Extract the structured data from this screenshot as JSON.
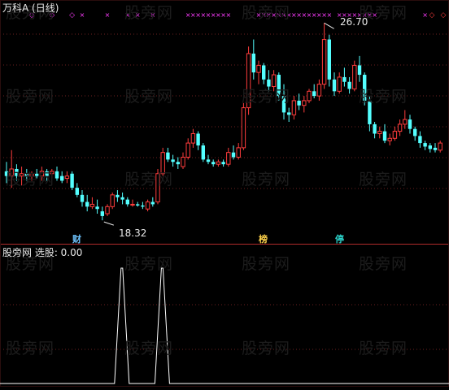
{
  "header": {
    "title": "万科A (日线)"
  },
  "price_panel": {
    "high_label": "26.70",
    "low_label": "18.32",
    "tags": [
      {
        "text": "财",
        "color": "#6fc5ff"
      },
      {
        "text": "榜",
        "color": "#ffd24a"
      },
      {
        "text": "停",
        "color": "#2bd1c9"
      }
    ],
    "colors": {
      "up": "#ff3c3c",
      "down": "#54ffff",
      "marker": "#ff3cff",
      "grid": "#6b1f1f",
      "divider": "#b02b2b"
    },
    "price_range": [
      17.6,
      27.4
    ],
    "candles": [
      [
        20.4,
        20.8,
        19.9,
        20.2
      ],
      [
        20.2,
        21.3,
        19.7,
        20.5
      ],
      [
        20.5,
        20.7,
        20.0,
        20.2
      ],
      [
        20.2,
        20.6,
        19.8,
        20.3
      ],
      [
        20.3,
        20.5,
        20.0,
        20.2
      ],
      [
        20.2,
        20.4,
        20.0,
        20.3
      ],
      [
        20.3,
        20.5,
        20.1,
        20.2
      ],
      [
        20.2,
        20.6,
        20.0,
        20.4
      ],
      [
        20.4,
        20.5,
        20.0,
        20.2
      ],
      [
        20.3,
        20.5,
        20.1,
        20.4
      ],
      [
        20.4,
        20.6,
        20.0,
        20.1
      ],
      [
        20.2,
        20.4,
        19.9,
        20.0
      ],
      [
        20.1,
        20.4,
        19.9,
        20.2
      ],
      [
        20.3,
        20.4,
        19.6,
        19.7
      ],
      [
        19.7,
        19.9,
        19.3,
        19.4
      ],
      [
        19.4,
        19.6,
        18.9,
        19.1
      ],
      [
        19.1,
        19.4,
        18.7,
        18.9
      ],
      [
        18.9,
        19.3,
        18.8,
        19.0
      ],
      [
        18.9,
        19.2,
        18.6,
        18.8
      ],
      [
        18.7,
        18.9,
        18.32,
        18.5
      ],
      [
        18.6,
        19.0,
        18.5,
        18.9
      ],
      [
        18.9,
        19.5,
        18.8,
        19.4
      ],
      [
        19.4,
        19.6,
        19.1,
        19.3
      ],
      [
        19.3,
        19.5,
        19.0,
        19.2
      ],
      [
        19.2,
        19.3,
        18.9,
        19.0
      ],
      [
        19.0,
        19.2,
        18.9,
        19.0
      ],
      [
        19.0,
        19.1,
        18.9,
        18.95
      ],
      [
        18.95,
        19.1,
        18.8,
        18.9
      ],
      [
        18.8,
        19.2,
        18.7,
        19.1
      ],
      [
        19.1,
        19.3,
        18.9,
        19.0
      ],
      [
        19.1,
        20.5,
        19.0,
        20.3
      ],
      [
        20.3,
        21.4,
        20.2,
        21.2
      ],
      [
        21.2,
        21.4,
        20.8,
        20.9
      ],
      [
        20.9,
        21.1,
        20.6,
        20.8
      ],
      [
        20.8,
        21.0,
        20.5,
        20.7
      ],
      [
        20.6,
        21.2,
        20.5,
        21.0
      ],
      [
        21.0,
        21.8,
        20.9,
        21.6
      ],
      [
        21.6,
        22.2,
        21.4,
        22.0
      ],
      [
        22.0,
        22.1,
        21.3,
        21.5
      ],
      [
        21.5,
        21.6,
        20.8,
        20.9
      ],
      [
        20.9,
        21.1,
        20.7,
        20.8
      ],
      [
        20.8,
        20.9,
        20.6,
        20.7
      ],
      [
        20.7,
        20.9,
        20.6,
        20.8
      ],
      [
        20.8,
        20.9,
        20.6,
        20.7
      ],
      [
        20.7,
        21.4,
        20.6,
        21.2
      ],
      [
        21.2,
        21.5,
        20.9,
        21.0
      ],
      [
        21.0,
        21.6,
        20.9,
        21.4
      ],
      [
        21.4,
        23.3,
        21.3,
        23.1
      ],
      [
        23.1,
        25.7,
        22.8,
        25.4
      ],
      [
        25.4,
        26.0,
        24.3,
        24.6
      ],
      [
        24.6,
        25.1,
        24.1,
        24.9
      ],
      [
        24.9,
        25.0,
        24.1,
        24.3
      ],
      [
        24.3,
        24.7,
        23.8,
        24.0
      ],
      [
        24.0,
        24.7,
        23.8,
        24.5
      ],
      [
        24.5,
        24.6,
        23.4,
        23.6
      ],
      [
        23.6,
        24.1,
        22.6,
        22.9
      ],
      [
        22.9,
        23.1,
        22.5,
        22.8
      ],
      [
        22.8,
        23.6,
        22.6,
        23.4
      ],
      [
        23.4,
        23.7,
        23.0,
        23.2
      ],
      [
        23.2,
        23.6,
        22.9,
        23.4
      ],
      [
        23.4,
        23.9,
        23.3,
        23.8
      ],
      [
        23.8,
        24.1,
        23.5,
        23.6
      ],
      [
        23.6,
        24.3,
        23.4,
        24.1
      ],
      [
        24.1,
        26.7,
        23.9,
        26.0
      ],
      [
        26.0,
        26.2,
        24.0,
        24.3
      ],
      [
        24.3,
        24.6,
        23.6,
        23.8
      ],
      [
        23.8,
        24.6,
        23.7,
        24.4
      ],
      [
        24.4,
        24.8,
        24.0,
        24.2
      ],
      [
        24.2,
        24.4,
        23.7,
        23.9
      ],
      [
        23.9,
        25.1,
        23.8,
        24.9
      ],
      [
        24.9,
        25.3,
        24.2,
        24.5
      ],
      [
        24.5,
        24.6,
        23.2,
        23.4
      ],
      [
        23.4,
        23.6,
        22.1,
        22.4
      ],
      [
        22.4,
        22.5,
        21.8,
        22.0
      ],
      [
        22.0,
        22.3,
        21.8,
        22.1
      ],
      [
        22.1,
        22.4,
        21.6,
        21.7
      ],
      [
        21.7,
        22.0,
        21.5,
        21.8
      ],
      [
        21.8,
        22.3,
        21.7,
        22.1
      ],
      [
        22.1,
        22.6,
        21.9,
        22.4
      ],
      [
        22.4,
        23.0,
        22.2,
        22.6
      ],
      [
        22.6,
        22.8,
        22.0,
        22.2
      ],
      [
        22.2,
        22.3,
        21.7,
        21.9
      ],
      [
        21.9,
        22.1,
        21.4,
        21.6
      ],
      [
        21.6,
        21.7,
        21.3,
        21.45
      ],
      [
        21.5,
        21.6,
        21.2,
        21.35
      ],
      [
        21.4,
        21.6,
        21.2,
        21.3
      ],
      [
        21.3,
        21.7,
        21.2,
        21.6
      ]
    ],
    "up_marker_days": [
      5,
      9,
      13
    ],
    "down_marker_days": [
      15,
      20,
      24,
      26,
      29,
      36,
      37,
      38,
      39,
      40,
      41,
      42,
      43,
      44,
      50,
      51,
      52,
      53,
      54,
      55,
      56,
      57,
      58,
      59,
      60,
      61,
      62,
      63,
      64,
      66,
      67,
      68,
      69,
      70,
      71,
      72,
      73,
      83
    ]
  },
  "indicator_panel": {
    "label": "股旁网 选股: 0.00",
    "signal_days": [
      19,
      27
    ],
    "line_color": "#ffffff"
  },
  "watermark": {
    "text": "股旁网"
  }
}
